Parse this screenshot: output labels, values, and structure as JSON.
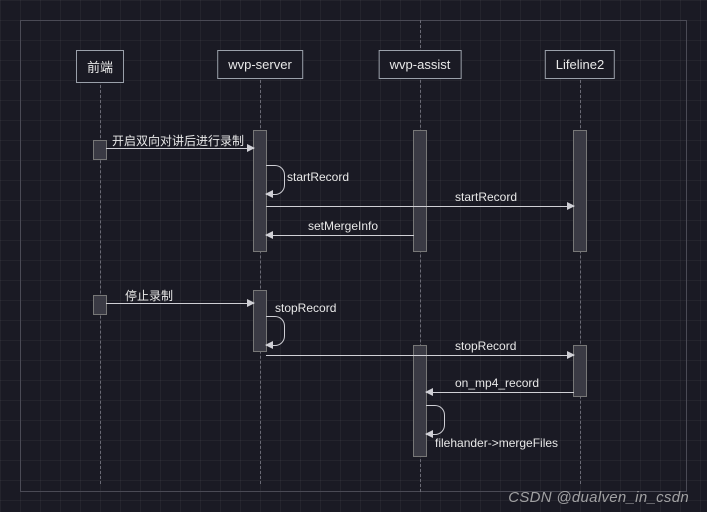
{
  "participants": {
    "frontend": "前端",
    "wvp_server": "wvp-server",
    "wvp_assist": "wvp-assist",
    "lifeline2": "Lifeline2"
  },
  "messages": {
    "start_broadcast": "开启双向对讲后进行录制",
    "start_record_self": "startRecord",
    "start_record_to_lifeline2": "startRecord",
    "set_merge_info": "setMergeInfo",
    "stop_broadcast": "停止录制",
    "stop_record_self": "stopRecord",
    "stop_record_to_lifeline2": "stopRecord",
    "on_mp4_record": "on_mp4_record",
    "merge_files": "filehander->mergeFiles"
  },
  "watermark": "CSDN @dualven_in_csdn",
  "chart_data": {
    "type": "sequence_diagram",
    "participants": [
      "前端",
      "wvp-server",
      "wvp-assist",
      "Lifeline2"
    ],
    "messages": [
      {
        "from": "前端",
        "to": "wvp-server",
        "label": "开启双向对讲后进行录制"
      },
      {
        "from": "wvp-server",
        "to": "wvp-server",
        "label": "startRecord",
        "self": true
      },
      {
        "from": "wvp-server",
        "to": "Lifeline2",
        "label": "startRecord"
      },
      {
        "from": "wvp-assist",
        "to": "wvp-server",
        "label": "setMergeInfo"
      },
      {
        "from": "前端",
        "to": "wvp-server",
        "label": "停止录制"
      },
      {
        "from": "wvp-server",
        "to": "wvp-server",
        "label": "stopRecord",
        "self": true
      },
      {
        "from": "wvp-server",
        "to": "Lifeline2",
        "label": "stopRecord"
      },
      {
        "from": "Lifeline2",
        "to": "wvp-assist",
        "label": "on_mp4_record"
      },
      {
        "from": "wvp-assist",
        "to": "wvp-assist",
        "label": "filehander->mergeFiles",
        "self": true
      }
    ]
  }
}
